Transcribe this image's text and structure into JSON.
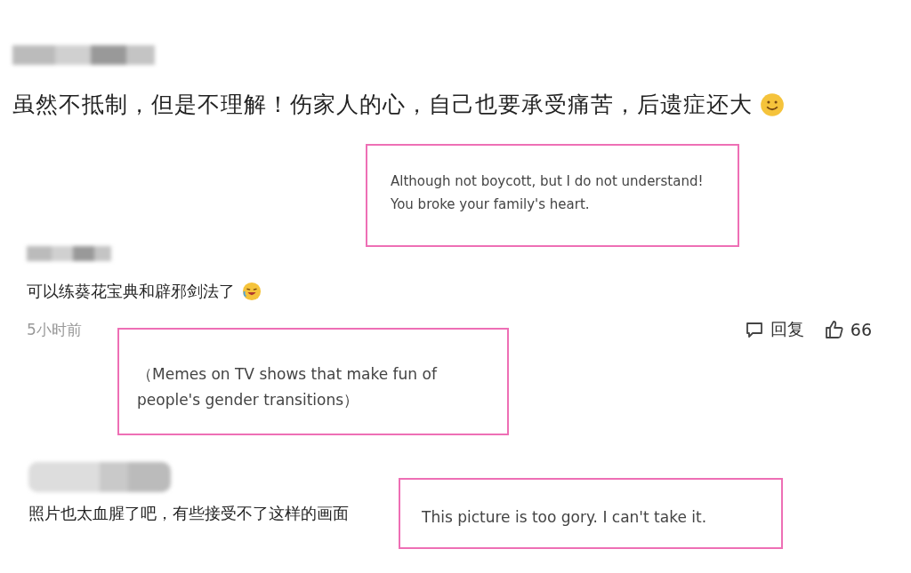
{
  "comments": [
    {
      "kind": "large",
      "text": "虽然不抵制，但是不理解！伤家人的心，自己也要承受痛苦，后遗症还大"
    },
    {
      "kind": "small",
      "text": "可以练葵花宝典和辟邪剑法了",
      "time": "5小时前",
      "reply": "回复",
      "likes": "66"
    },
    {
      "kind": "small",
      "text": "照片也太血腥了吧，有些接受不了这样的画面"
    }
  ],
  "annotations": [
    {
      "text": "Although not boycott, but I do not understand! You broke your family's heart."
    },
    {
      "text": "（Memes on TV shows that make fun of people's gender transitions）"
    },
    {
      "text": "This picture is too gory. I can't take it."
    }
  ]
}
